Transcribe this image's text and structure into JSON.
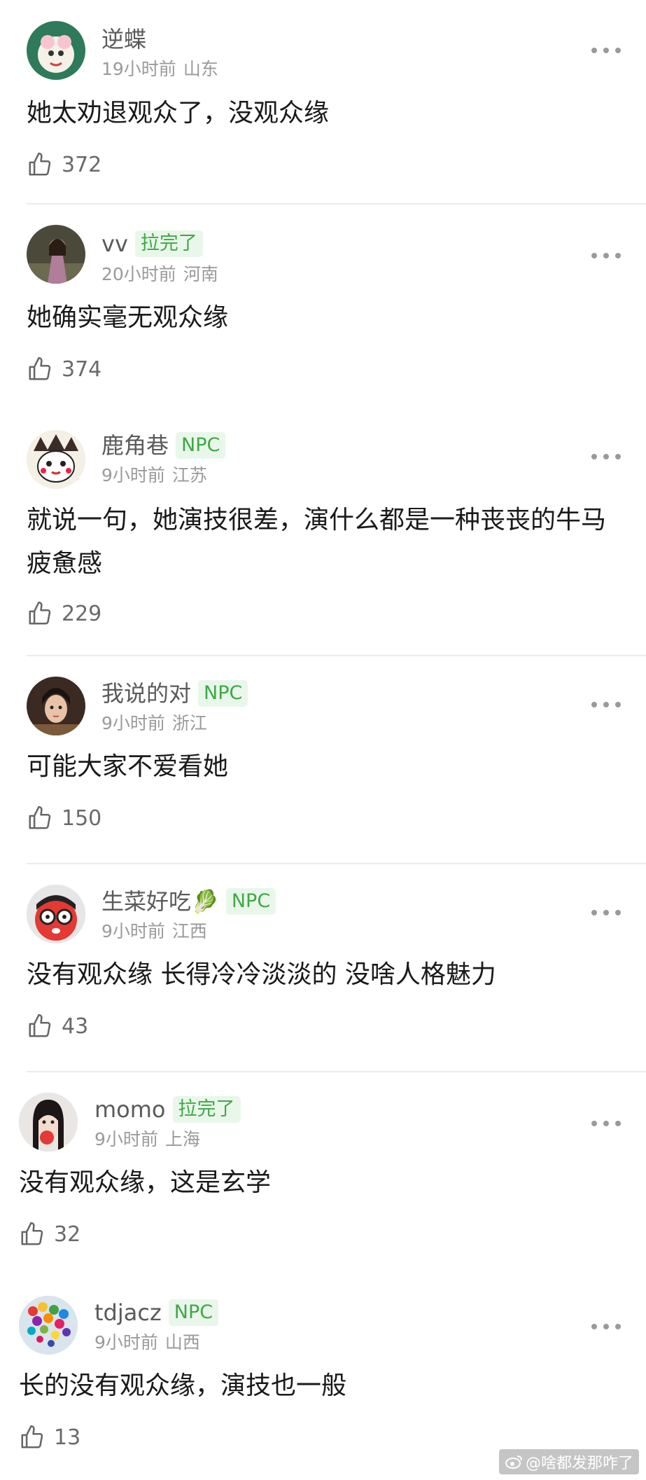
{
  "comments": [
    {
      "username": "逆蝶",
      "badge": "",
      "time": "19小时前",
      "location": "山东",
      "content": "她太劝退观众了，没观众缘",
      "likes": "372"
    },
    {
      "username": "vv",
      "badge": "拉完了",
      "time": "20小时前",
      "location": "河南",
      "content": "她确实毫无观众缘",
      "likes": "374"
    },
    {
      "username": "鹿角巷",
      "badge": "NPC",
      "time": "9小时前",
      "location": "江苏",
      "content": "就说一句，她演技很差，演什么都是一种丧丧的牛马疲惫感",
      "likes": "229"
    },
    {
      "username": "我说的对",
      "badge": "NPC",
      "time": "9小时前",
      "location": "浙江",
      "content": "可能大家不爱看她",
      "likes": "150"
    },
    {
      "username": "生菜好吃🥬",
      "badge": "NPC",
      "time": "9小时前",
      "location": "江西",
      "content": "没有观众缘 长得冷冷淡淡的 没啥人格魅力",
      "likes": "43"
    },
    {
      "username": "momo",
      "badge": "拉完了",
      "time": "9小时前",
      "location": "上海",
      "content": "没有观众缘，这是玄学",
      "likes": "32"
    },
    {
      "username": "tdjacz",
      "badge": "NPC",
      "time": "9小时前",
      "location": "山西",
      "content": "长的没有观众缘，演技也一般",
      "likes": "13"
    }
  ],
  "watermark": "@啥都发那咋了",
  "colors": {
    "badge_bg": "#e9f7ea",
    "badge_text": "#3fa845",
    "meta": "#9a9a9a",
    "divider": "#ececec"
  }
}
